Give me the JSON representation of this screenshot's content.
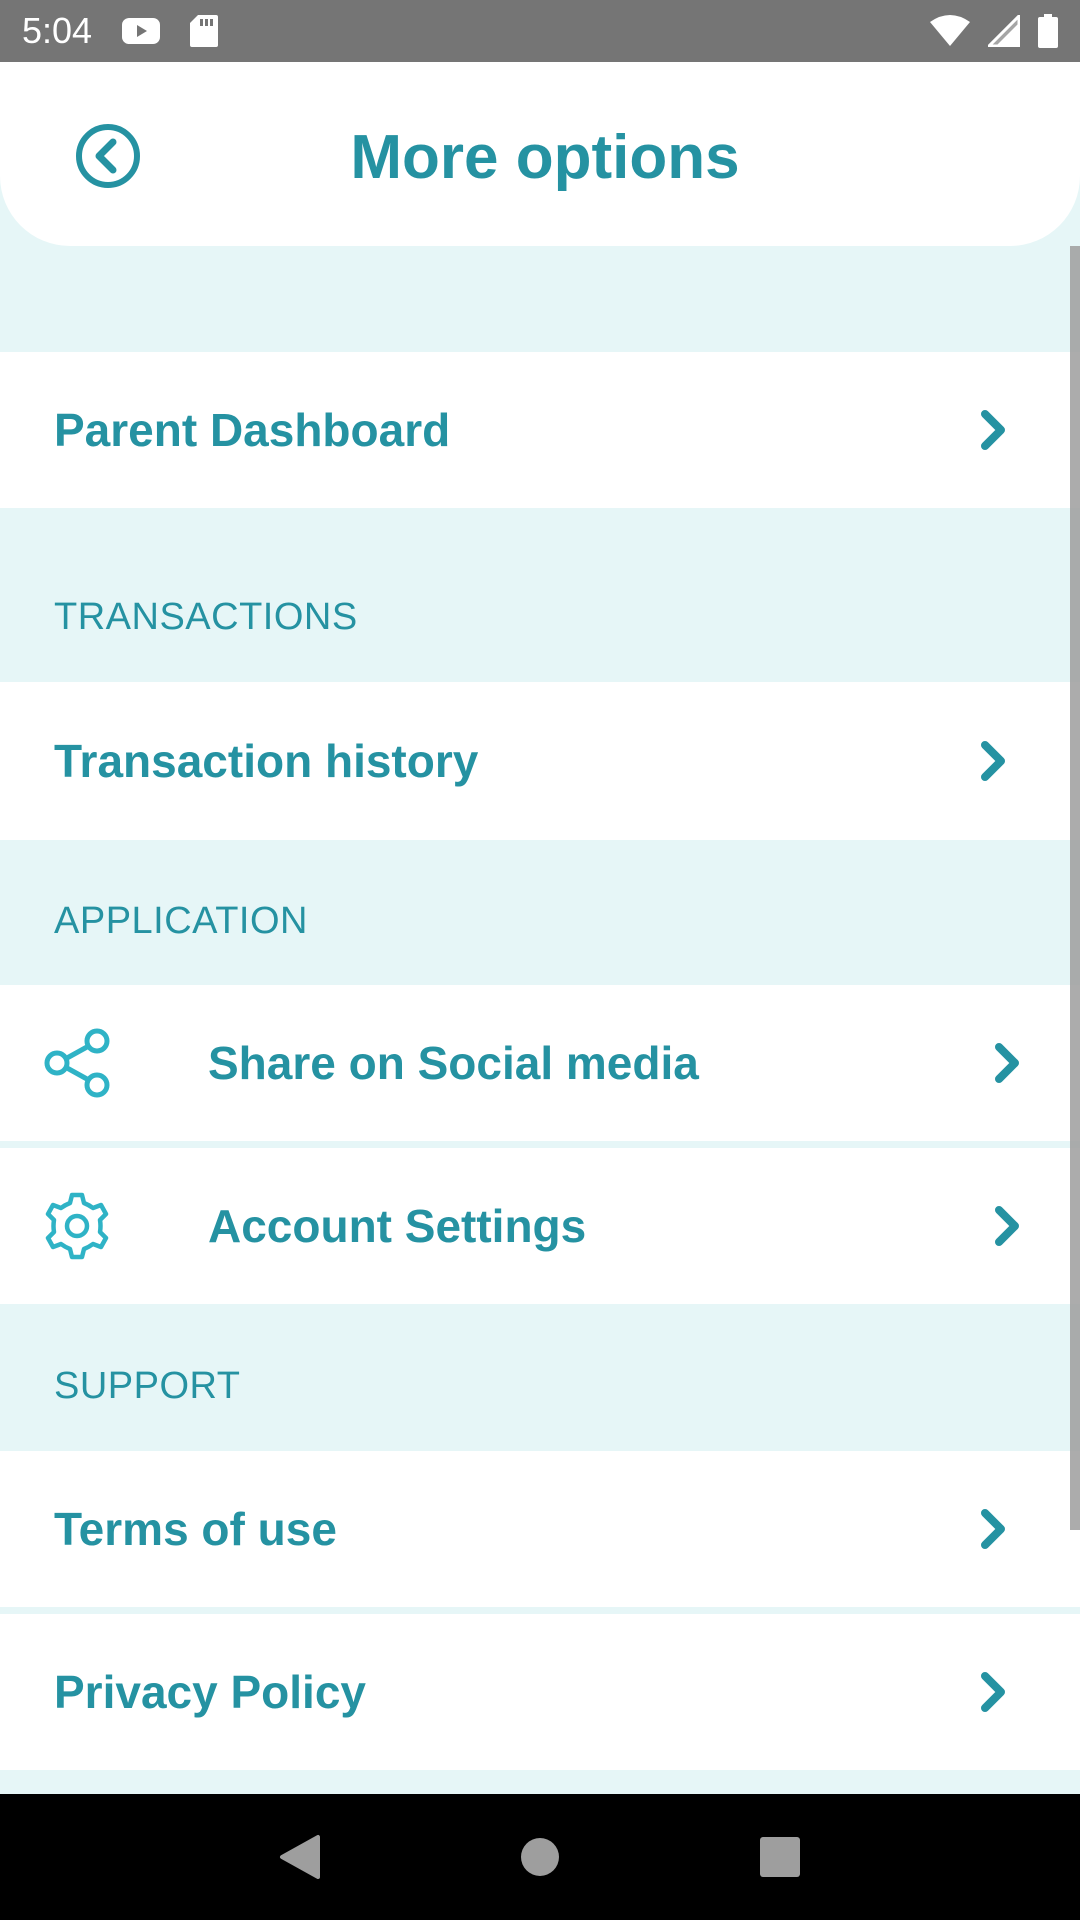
{
  "status_bar": {
    "time": "5:04",
    "icons": [
      "youtube-icon",
      "sd-card-icon",
      "wifi-icon",
      "cell-signal-icon",
      "battery-icon"
    ]
  },
  "header": {
    "title": "More options",
    "back_icon": "circle-chevron-left-icon"
  },
  "menu": {
    "parent_dashboard": "Parent Dashboard",
    "sections": {
      "transactions": "TRANSACTIONS",
      "application": "APPLICATION",
      "support": "SUPPORT"
    },
    "transaction_history": "Transaction history",
    "share_social": "Share on Social media",
    "account_settings": "Account Settings",
    "terms_of_use": "Terms of use",
    "privacy_policy": "Privacy Policy"
  },
  "nav_bar": {
    "icons": [
      "back-triangle-icon",
      "home-circle-icon",
      "recents-square-icon"
    ]
  },
  "colors": {
    "accent": "#2592a2",
    "background": "#e6f6f7",
    "icon_light": "#2fb3c6",
    "status_bar": "#757575"
  }
}
